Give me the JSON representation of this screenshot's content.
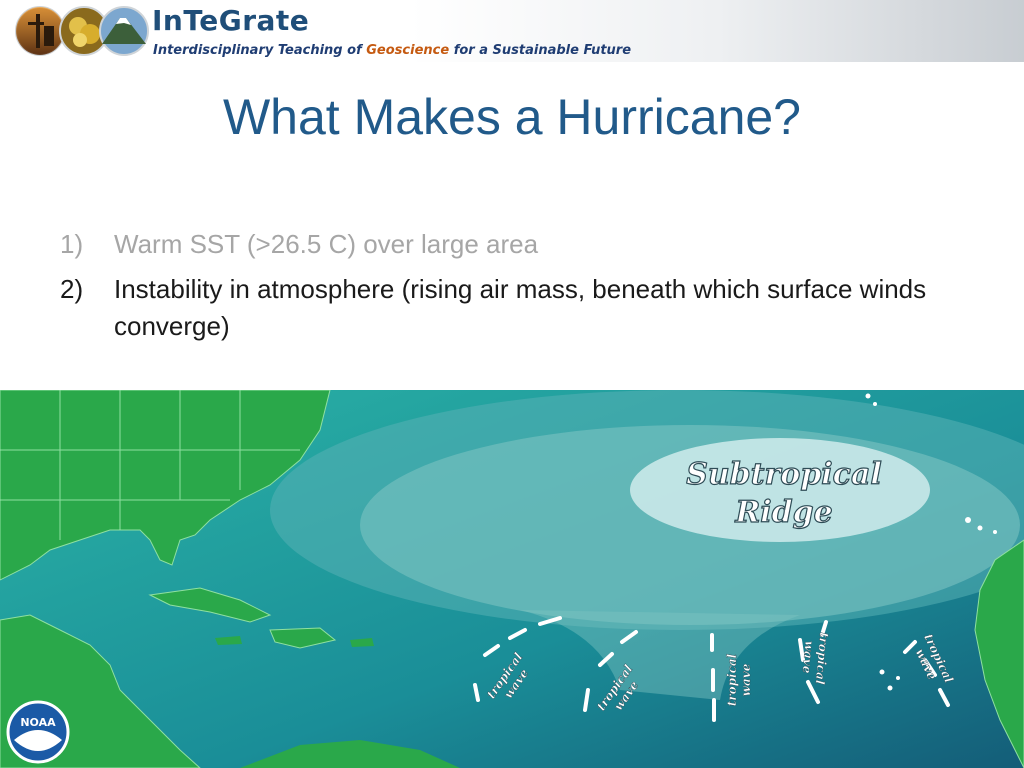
{
  "header": {
    "brand_name": "InTeGrate",
    "tagline_part1": "Interdisciplinary Teaching of ",
    "tagline_part2": "Geoscience",
    "tagline_part3": " for a Sustainable Future",
    "logo_icons": [
      "oil-rig-icon",
      "mineral-icon",
      "volcano-icon"
    ]
  },
  "slide": {
    "title": "What Makes a Hurricane?",
    "bullets": [
      {
        "number": "1)",
        "text": "Warm SST (>26.5 C) over large area",
        "state": "dimmed"
      },
      {
        "number": "2)",
        "text": "Instability in atmosphere (rising air mass, beneath which surface winds converge)",
        "state": "active"
      }
    ]
  },
  "map": {
    "ridge_label_line1": "Subtropical",
    "ridge_label_line2": "Ridge",
    "wave_label_line1": "tropical",
    "wave_label_line2": "wave",
    "badge_text": "NOAA",
    "colors": {
      "ocean": "#1a7f8c",
      "land": "#26a63f",
      "ridge_light": "#c4e6e6",
      "label": "#ffffff"
    }
  }
}
